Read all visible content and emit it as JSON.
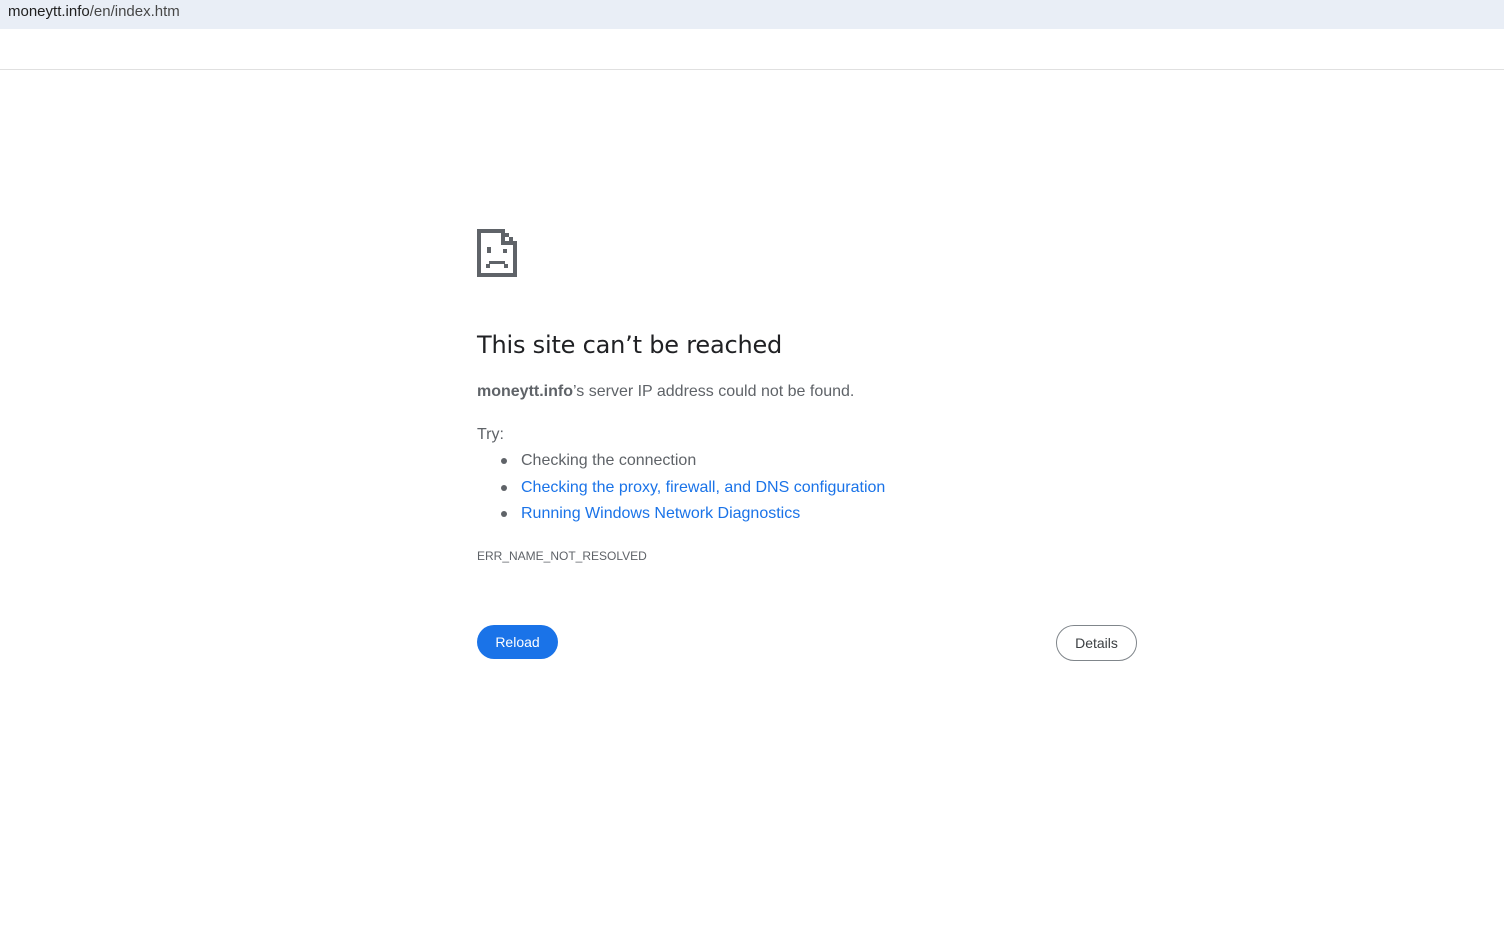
{
  "address_bar": {
    "domain": "moneytt.info",
    "path": "/en/index.htm"
  },
  "error_page": {
    "icon": "sad-page-icon",
    "heading": "This site can’t be reached",
    "summary_host": "moneytt.info",
    "summary_rest": "’s server IP address could not be found.",
    "try_label": "Try:",
    "suggestions": [
      {
        "text": "Checking the connection",
        "is_link": false
      },
      {
        "text": "Checking the proxy, firewall, and DNS configuration",
        "is_link": true
      },
      {
        "text": "Running Windows Network Diagnostics",
        "is_link": true
      }
    ],
    "error_code": "ERR_NAME_NOT_RESOLVED",
    "reload_label": "Reload",
    "details_label": "Details"
  },
  "colors": {
    "accent": "#1a73e8",
    "text_primary": "#202124",
    "text_secondary": "#5f6368",
    "address_bar_bg": "#e9eef6"
  }
}
